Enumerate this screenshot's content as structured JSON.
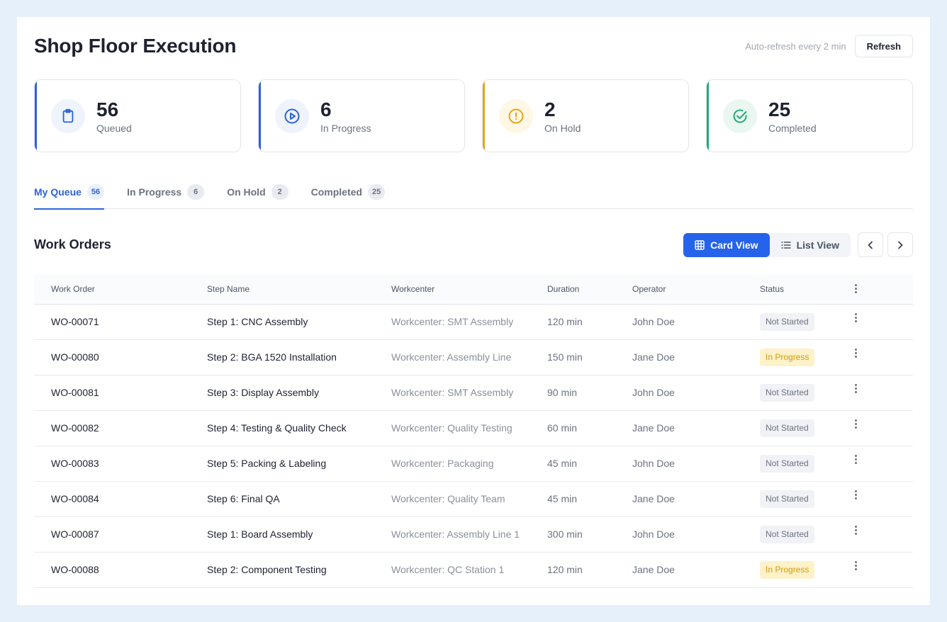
{
  "header": {
    "title": "Shop Floor Execution",
    "autorefresh": "Auto-refresh every 2 min",
    "refresh_label": "Refresh"
  },
  "stats": [
    {
      "value": "56",
      "label": "Queued",
      "icon": "clipboard-icon",
      "accent": "#2c63d6"
    },
    {
      "value": "6",
      "label": "In Progress",
      "icon": "play-circle-icon",
      "accent": "#2c63d6"
    },
    {
      "value": "2",
      "label": "On Hold",
      "icon": "alert-circle-icon",
      "accent": "#e8a317"
    },
    {
      "value": "25",
      "label": "Completed",
      "icon": "check-circle-icon",
      "accent": "#1fad73"
    }
  ],
  "tabs": [
    {
      "label": "My Queue",
      "count": "56",
      "active": true
    },
    {
      "label": "In Progress",
      "count": "6"
    },
    {
      "label": "On Hold",
      "count": "2"
    },
    {
      "label": "Completed",
      "count": "25"
    }
  ],
  "section": {
    "title": "Work Orders",
    "card_view": "Card View",
    "list_view": "List View"
  },
  "table": {
    "headers": [
      "Work Order",
      "Step Name",
      "Workcenter",
      "Duration",
      "Operator",
      "Status"
    ],
    "rows": [
      {
        "wo": "WO-00071",
        "step": "Step 1: CNC Assembly",
        "wc": "Workcenter: SMT Assembly",
        "dur": "120 min",
        "op": "John Doe",
        "status": "Not Started"
      },
      {
        "wo": "WO-00080",
        "step": "Step 2: BGA 1520 Installation",
        "wc": "Workcenter: Assembly Line",
        "dur": "150 min",
        "op": "Jane Doe",
        "status": "In Progress"
      },
      {
        "wo": "WO-00081",
        "step": "Step 3: Display Assembly",
        "wc": "Workcenter: SMT Assembly",
        "dur": "90 min",
        "op": "John Doe",
        "status": "Not Started"
      },
      {
        "wo": "WO-00082",
        "step": "Step 4: Testing & Quality Check",
        "wc": "Workcenter: Quality Testing",
        "dur": "60 min",
        "op": "Jane Doe",
        "status": "Not Started"
      },
      {
        "wo": "WO-00083",
        "step": "Step 5: Packing & Labeling",
        "wc": "Workcenter: Packaging",
        "dur": "45 min",
        "op": "John Doe",
        "status": "Not Started"
      },
      {
        "wo": "WO-00084",
        "step": "Step 6: Final QA",
        "wc": "Workcenter: Quality Team",
        "dur": "45 min",
        "op": "Jane Doe",
        "status": "Not Started"
      },
      {
        "wo": "WO-00087",
        "step": "Step 1: Board Assembly",
        "wc": "Workcenter: Assembly Line 1",
        "dur": "300 min",
        "op": "John Doe",
        "status": "Not Started"
      },
      {
        "wo": "WO-00088",
        "step": "Step 2: Component Testing",
        "wc": "Workcenter: QC Station 1",
        "dur": "120 min",
        "op": "Jane Doe",
        "status": "In Progress"
      }
    ]
  }
}
